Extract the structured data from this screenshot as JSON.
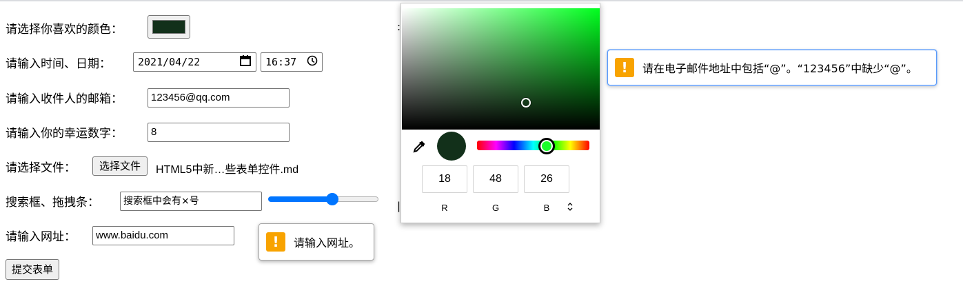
{
  "form": {
    "color": {
      "label": "请选择你喜欢的颜色：",
      "value_hex": "#12301a"
    },
    "datetime": {
      "label": "请输入时间、日期：",
      "date_value": "2021/04/22",
      "time_value": "16:37",
      "calendar_icon": "calendar-icon",
      "clock_icon": "clock-icon"
    },
    "email": {
      "label": "请输入收件人的邮箱：",
      "value": "123456@qq.com"
    },
    "number": {
      "label": "请输入你的幸运数字：",
      "value": "8"
    },
    "file": {
      "label": "请选择文件：",
      "button_label": "选择文件",
      "filename": "HTML5中新…些表单控件.md"
    },
    "search": {
      "label": "搜索框、拖拽条：",
      "value": "搜索框中会有×号",
      "range_value_fraction": 0.58
    },
    "url": {
      "label": "请输入网址：",
      "value": "www.baidu.com"
    },
    "submit": {
      "label": "提交表单"
    }
  },
  "validation": {
    "email_message": "请在电子邮件地址中包括“@”。“123456”中缺少“@”。",
    "url_message": "请输入网址。",
    "icon": "warning-icon"
  },
  "color_picker": {
    "r": "18",
    "g": "48",
    "b": "26",
    "r_label": "R",
    "g_label": "G",
    "b_label": "B",
    "mode_toggle": "⌃⌄",
    "eyedropper_icon": "eyedropper-icon",
    "hue_fraction": 0.62,
    "accent_color": "#0075ff"
  }
}
